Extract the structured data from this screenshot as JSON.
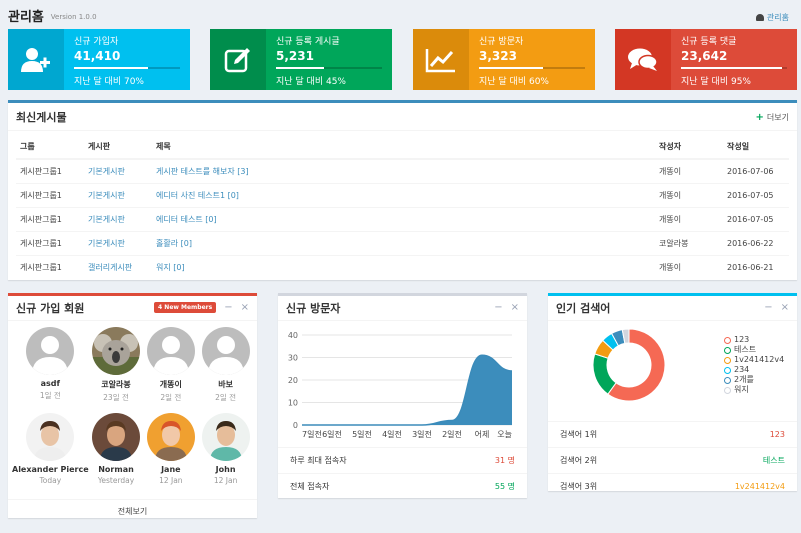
{
  "header": {
    "title": "관리홈",
    "version": "Version 1.0.0",
    "breadcrumb": "관리홈"
  },
  "info_boxes": [
    {
      "text": "신규 가입자",
      "number": "41,410",
      "desc": "지난 달 대비 70%",
      "progress": 70,
      "color": "#00c0ef",
      "icon_color": "#00a7d0",
      "icon": "user-plus-icon"
    },
    {
      "text": "신규 등록 게시글",
      "number": "5,231",
      "desc": "지난 달 대비 45%",
      "progress": 45,
      "color": "#00a65a",
      "icon_color": "#008d4c",
      "icon": "edit-icon"
    },
    {
      "text": "신규 방문자",
      "number": "3,323",
      "desc": "지난 달 대비 60%",
      "progress": 60,
      "color": "#f39c12",
      "icon_color": "#db8b0b",
      "icon": "line-chart-icon"
    },
    {
      "text": "신규 등록 댓글",
      "number": "23,642",
      "desc": "지난 달 대비 95%",
      "progress": 95,
      "color": "#dd4b39",
      "icon_color": "#d33724",
      "icon": "comments-icon"
    }
  ],
  "latest_posts": {
    "title": "최신게시물",
    "more": "더보기",
    "columns": [
      "그룹",
      "게시판",
      "제목",
      "작성자",
      "작성일"
    ],
    "rows": [
      [
        "게시판그룹1",
        "기본게시판",
        "게시판 테스트를 해보자 [3]",
        "개똥이",
        "2016-07-06"
      ],
      [
        "게시판그룹1",
        "기본게시판",
        "에디터 사진 테스트1 [0]",
        "개똥이",
        "2016-07-05"
      ],
      [
        "게시판그룹1",
        "기본게시판",
        "에디터 테스트 [0]",
        "개똥이",
        "2016-07-05"
      ],
      [
        "게시판그룹1",
        "기본게시판",
        "홀활라 [0]",
        "코알라봉",
        "2016-06-22"
      ],
      [
        "게시판그룹1",
        "갤러리게시판",
        "워지 [0]",
        "개똥이",
        "2016-06-21"
      ]
    ]
  },
  "new_members": {
    "title": "신규 가입 회원",
    "badge": "4 New Members",
    "footer": "전체보기",
    "members": [
      {
        "name": "asdf",
        "date": "1일 전",
        "avatar": "default-avatar"
      },
      {
        "name": "코알라봉",
        "date": "23일 전",
        "avatar": "koala-photo"
      },
      {
        "name": "개똥이",
        "date": "2일 전",
        "avatar": "default-avatar"
      },
      {
        "name": "바보",
        "date": "2일 전",
        "avatar": "default-avatar"
      },
      {
        "name": "Alexander Pierce",
        "date": "Today",
        "avatar": "man-1-photo"
      },
      {
        "name": "Norman",
        "date": "Yesterday",
        "avatar": "man-2-photo"
      },
      {
        "name": "Jane",
        "date": "12 Jan",
        "avatar": "woman-photo"
      },
      {
        "name": "John",
        "date": "12 Jan",
        "avatar": "man-3-photo"
      }
    ]
  },
  "visitors": {
    "title": "신규 방문자",
    "stats": [
      {
        "label": "하루 최대 접속자",
        "value": "31 명",
        "color": "#dd4b39"
      },
      {
        "label": "전체 접속자",
        "value": "55 명",
        "color": "#00a65a"
      }
    ]
  },
  "popular_search": {
    "title": "인기 검색어",
    "ranks": [
      {
        "label": "검색어 1위",
        "value": "123",
        "color": "#dd4b39"
      },
      {
        "label": "검색어 2위",
        "value": "테스트",
        "color": "#00a65a"
      },
      {
        "label": "검색어 3위",
        "value": "1v241412v4",
        "color": "#f39c12"
      }
    ]
  },
  "chart_data": [
    {
      "type": "area",
      "title": "신규 방문자",
      "categories": [
        "7일전",
        "6일전",
        "5일전",
        "4일전",
        "3일전",
        "2일전",
        "어제",
        "오늘"
      ],
      "values": [
        0,
        0,
        0,
        0,
        0,
        2,
        31,
        24
      ],
      "y_ticks": [
        0,
        10,
        20,
        30,
        40
      ],
      "ylim": [
        0,
        40
      ],
      "color": "#3c8dbc"
    },
    {
      "type": "pie",
      "title": "인기 검색어",
      "labels": [
        "123",
        "테스트",
        "1v241412v4",
        "234",
        "2개를",
        "워지"
      ],
      "values": [
        60,
        20,
        7,
        5,
        5,
        3
      ],
      "colors": [
        "#f56954",
        "#00a65a",
        "#f39c12",
        "#00c0ef",
        "#3c8dbc",
        "#d2d6de"
      ]
    }
  ]
}
